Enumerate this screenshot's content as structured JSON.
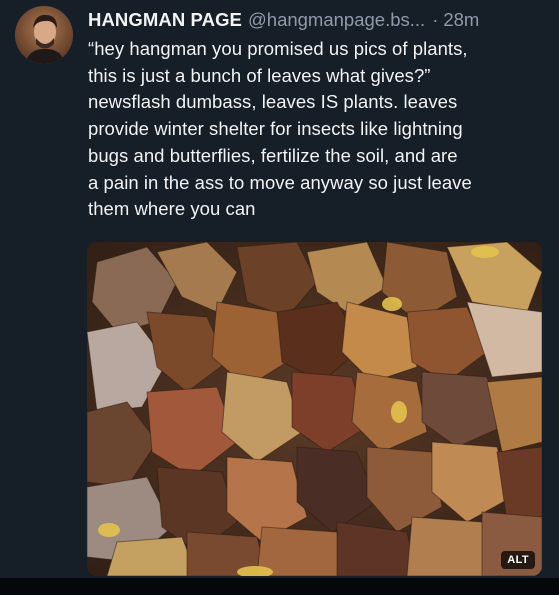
{
  "post": {
    "author": {
      "display_name": "HANGMAN PAGE",
      "handle": "@hangmanpage.bs...",
      "avatar_icon": "avatar-photo"
    },
    "separator": "·",
    "timestamp": "28m",
    "text_lines": [
      "“hey hangman you promised us pics of plants,",
      "this is just a bunch of leaves what gives?”",
      "newsflash dumbass, leaves IS plants.  leaves",
      "provide winter shelter for insects like lightning",
      "bugs and butterflies, fertilize the soil, and are",
      "a pain in the ass to move anyway so just leave",
      "them where you can"
    ],
    "image": {
      "alt_badge": "ALT"
    }
  },
  "colors": {
    "background": "#161e27",
    "text": "#f1f3f5",
    "muted": "#8f9ba9"
  }
}
